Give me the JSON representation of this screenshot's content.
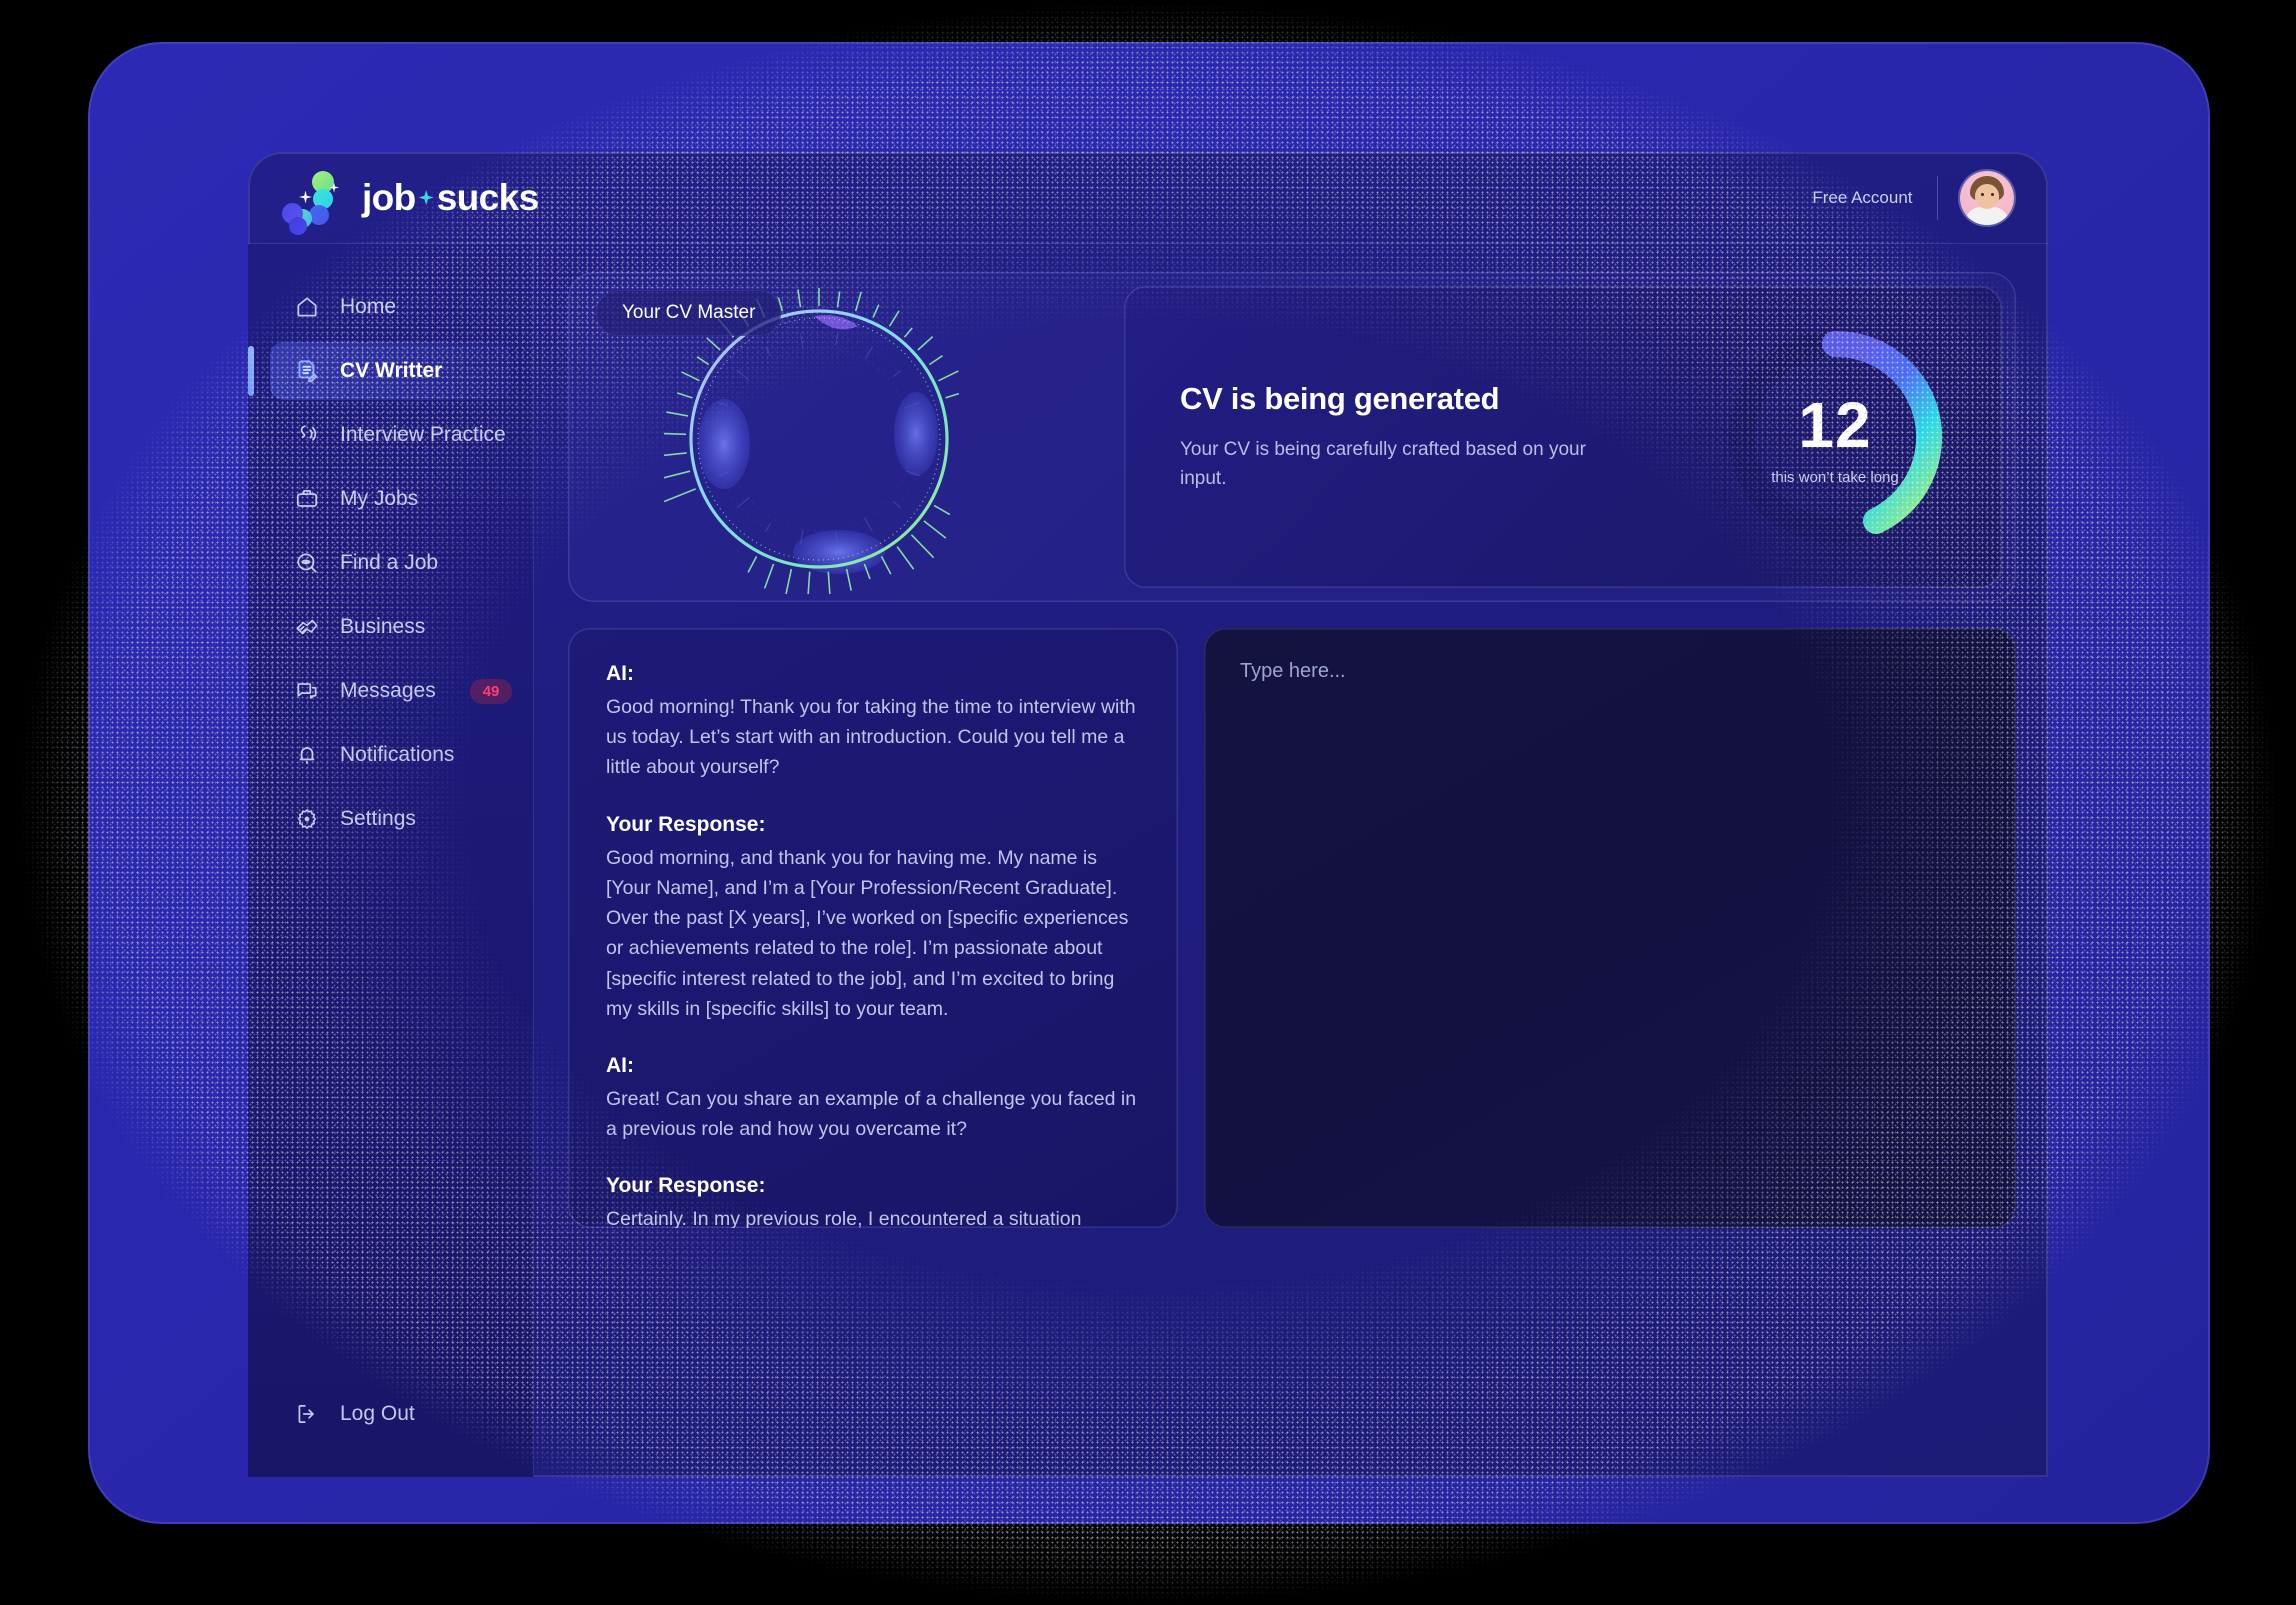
{
  "brand": {
    "name_part1": "job",
    "name_part2": "sucks",
    "logo_icon": "gradient-dot-cluster-icon"
  },
  "header": {
    "account_label": "Free Account",
    "avatar_icon": "user-avatar"
  },
  "sidebar": {
    "items": [
      {
        "label": "Home",
        "icon": "home-icon",
        "active": false
      },
      {
        "label": "CV Writter",
        "icon": "document-pen-icon",
        "active": true
      },
      {
        "label": "Interview Practice",
        "icon": "voice-wave-icon",
        "active": false
      },
      {
        "label": "My Jobs",
        "icon": "briefcase-icon",
        "active": false
      },
      {
        "label": "Find a Job",
        "icon": "search-eye-icon",
        "active": false
      },
      {
        "label": "Business",
        "icon": "handshake-icon",
        "active": false
      },
      {
        "label": "Messages",
        "icon": "chat-icon",
        "active": false,
        "badge": "49"
      },
      {
        "label": "Notifications",
        "icon": "bell-icon",
        "active": false
      },
      {
        "label": "Settings",
        "icon": "gear-icon",
        "active": false
      }
    ],
    "logout": {
      "label": "Log Out",
      "icon": "logout-icon"
    }
  },
  "main": {
    "chip_label": "Your CV Master",
    "generation": {
      "title": "CV is being generated",
      "subtitle": "Your CV is being  carefully crafted based on your input.",
      "counter": "12",
      "counter_caption": "this won’t take long"
    },
    "chat": [
      {
        "role": "AI:",
        "text": "Good morning! Thank you for taking the time to interview with us today. Let’s start with an introduction. Could you tell me a little about yourself?"
      },
      {
        "role": "Your Response:",
        "text": "Good morning, and thank you for having me. My name is [Your Name], and I’m a [Your Profession/Recent Graduate]. Over the past [X years], I’ve worked on [specific experiences or achievements related to the role]. I’m passionate about [specific interest related to the job], and I’m excited to bring my skills in [specific skills] to your team."
      },
      {
        "role": "AI:",
        "text": "Great! Can you share an example of a challenge you faced in a previous role and how you overcame it?"
      },
      {
        "role": "Your Response:",
        "text": "Certainly. In my previous role, I encountered a situation where [describe"
      }
    ],
    "composer": {
      "placeholder": "Type here..."
    }
  },
  "colors": {
    "device_frame": "#2c29b4",
    "app_background": "#201d82",
    "sidebar": "#1b1873",
    "card": "#1e1a74",
    "composer": "#131142",
    "accent_blue": "#8fb6ff",
    "badge_text": "#ff3d6e",
    "ring_gradient_start": "#4a52e8",
    "ring_gradient_mid": "#27d9e8",
    "ring_gradient_end": "#a6f07a"
  }
}
